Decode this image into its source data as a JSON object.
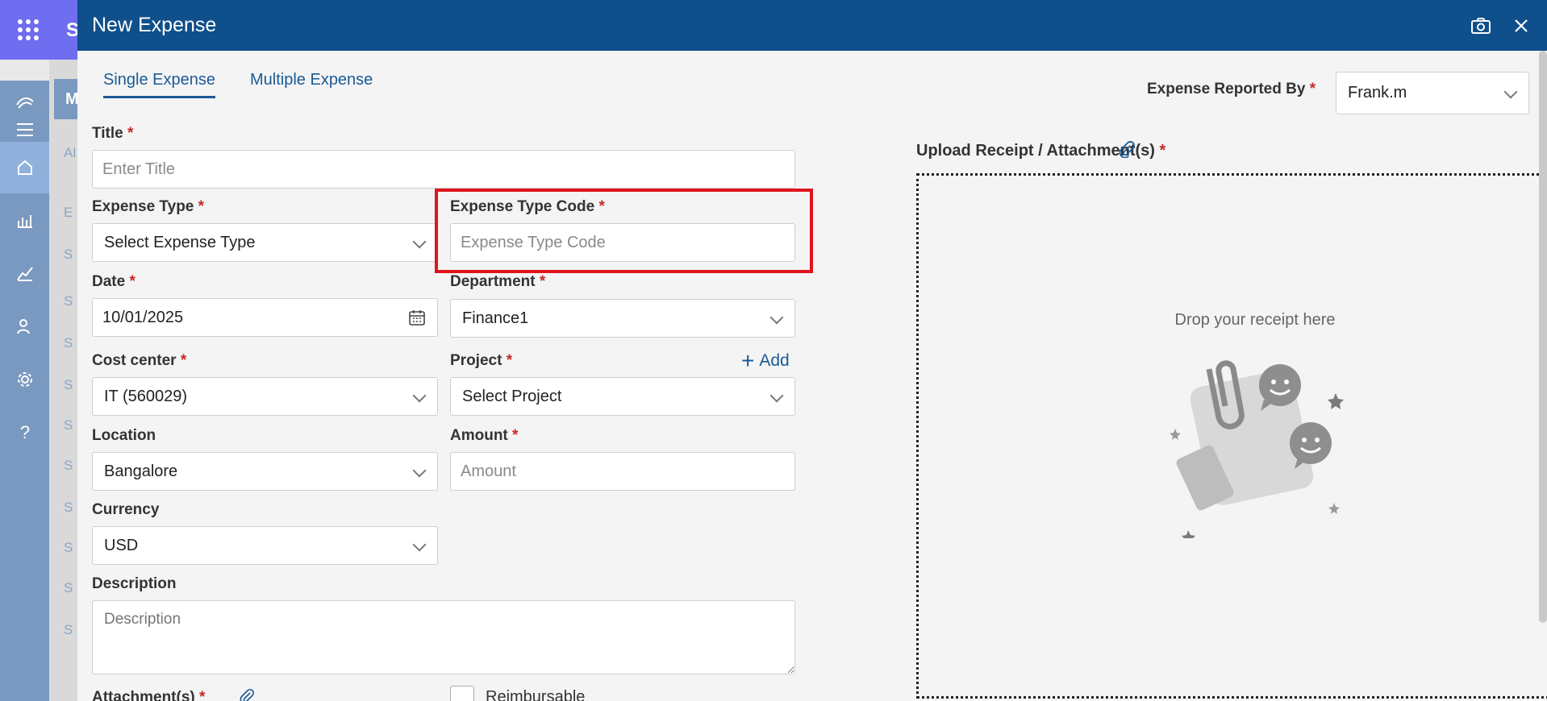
{
  "app": {
    "title_letter": "S",
    "sidebar_letter": "M",
    "bg_letters": [
      "Al",
      "E",
      "S",
      "S",
      "S",
      "S",
      "S",
      "S",
      "S",
      "S",
      "S",
      "S"
    ]
  },
  "modal": {
    "title": "New Expense"
  },
  "tabs": [
    {
      "label": "Single Expense",
      "active": true
    },
    {
      "label": "Multiple Expense",
      "active": false
    }
  ],
  "reported_by": {
    "label": "Expense Reported By",
    "value": "Frank.m"
  },
  "form": {
    "title": {
      "label": "Title",
      "placeholder": "Enter Title"
    },
    "expense_type": {
      "label": "Expense Type",
      "value": "Select Expense Type"
    },
    "expense_type_code": {
      "label": "Expense Type Code",
      "placeholder": "Expense Type Code"
    },
    "date": {
      "label": "Date",
      "value": "10/01/2025"
    },
    "department": {
      "label": "Department",
      "value": "Finance1"
    },
    "cost_center": {
      "label": "Cost center",
      "value": "IT (560029)"
    },
    "project": {
      "label": "Project",
      "value": "Select Project",
      "add_label": "Add"
    },
    "location": {
      "label": "Location",
      "value": "Bangalore"
    },
    "amount": {
      "label": "Amount",
      "placeholder": "Amount"
    },
    "currency": {
      "label": "Currency",
      "value": "USD"
    },
    "description": {
      "label": "Description",
      "placeholder": "Description"
    },
    "attachments": {
      "label": "Attachment(s)"
    },
    "reimbursable": {
      "label": "Reimbursable"
    }
  },
  "upload": {
    "label": "Upload Receipt / Attachment(s)",
    "drop_text": "Drop your receipt here"
  },
  "required_marker": "*",
  "colors": {
    "header": "#0f4f8b",
    "accent": "#1a5a96",
    "required": "#c62828",
    "highlight": "#e0141e"
  }
}
